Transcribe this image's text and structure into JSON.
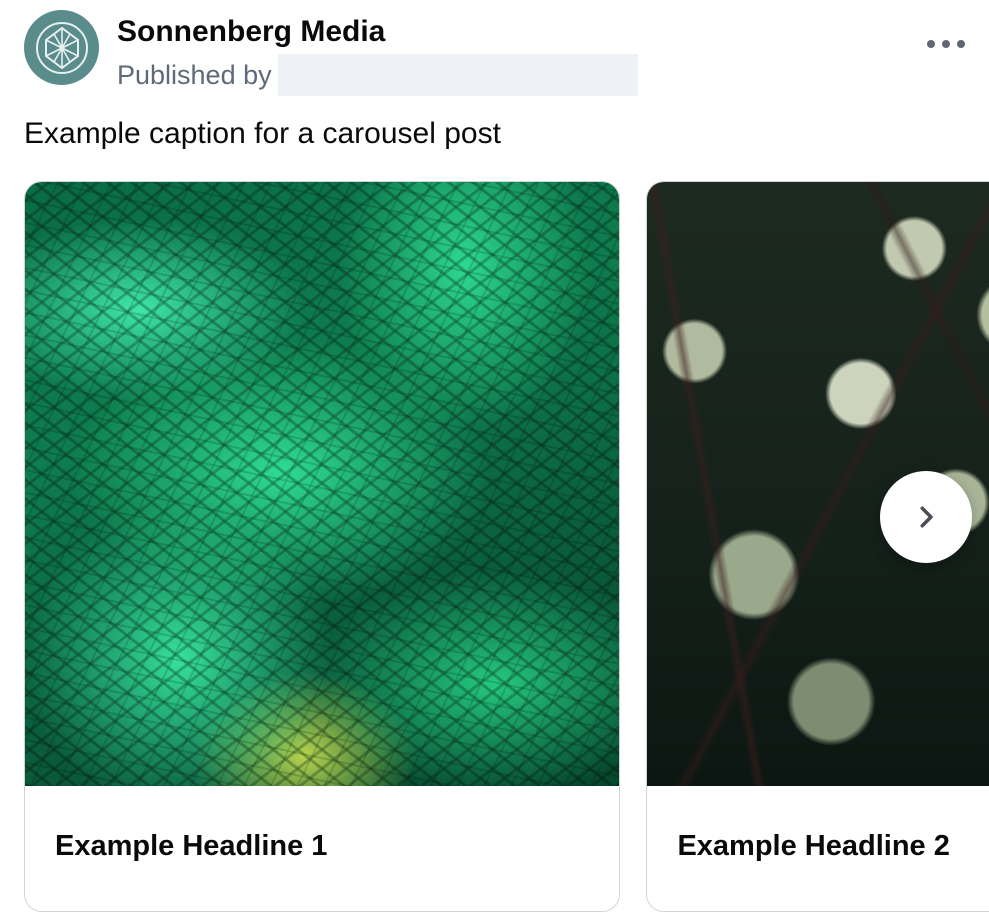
{
  "header": {
    "page_name": "Sonnenberg Media",
    "published_by_label": "Published by"
  },
  "caption": "Example caption for a carousel post",
  "carousel": {
    "cards": [
      {
        "headline": "Example Headline 1"
      },
      {
        "headline": "Example Headline 2"
      }
    ]
  },
  "icons": {
    "more": "more-horizontal",
    "next": "chevron-right",
    "avatar": "leaf-logo"
  },
  "colors": {
    "avatar_bg": "#5a8c8c",
    "text_primary": "#0a0a0a",
    "text_secondary": "#5f6a78"
  }
}
